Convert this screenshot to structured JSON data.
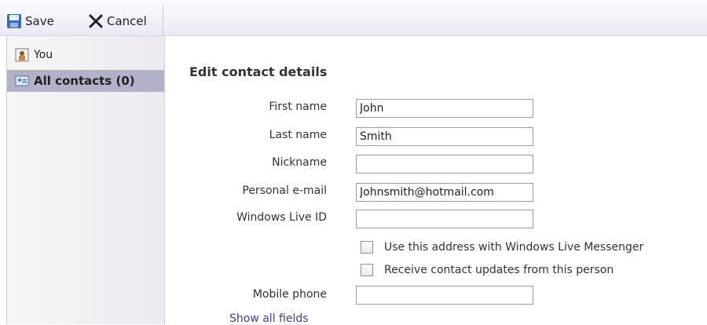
{
  "toolbar": {
    "save_label": "Save",
    "cancel_label": "Cancel"
  },
  "sidebar": {
    "items": [
      {
        "label": "You",
        "icon": "person-card-icon"
      },
      {
        "label": "All contacts (0)",
        "icon": "contacts-card-icon"
      }
    ]
  },
  "form": {
    "title": "Edit contact details",
    "fields": [
      {
        "label": "First name",
        "value": "John"
      },
      {
        "label": "Last name",
        "value": "Smith"
      },
      {
        "label": "Nickname",
        "value": ""
      },
      {
        "label": "Personal e-mail",
        "value": "Johnsmith@hotmail.com"
      },
      {
        "label": "Windows Live ID",
        "value": ""
      }
    ],
    "checkboxes": [
      {
        "label": "Use this address with Windows Live Messenger",
        "checked": false
      },
      {
        "label": "Receive contact updates from this person",
        "checked": false
      }
    ],
    "mobile": {
      "label": "Mobile phone",
      "value": ""
    },
    "show_all_link": "Show all fields"
  }
}
